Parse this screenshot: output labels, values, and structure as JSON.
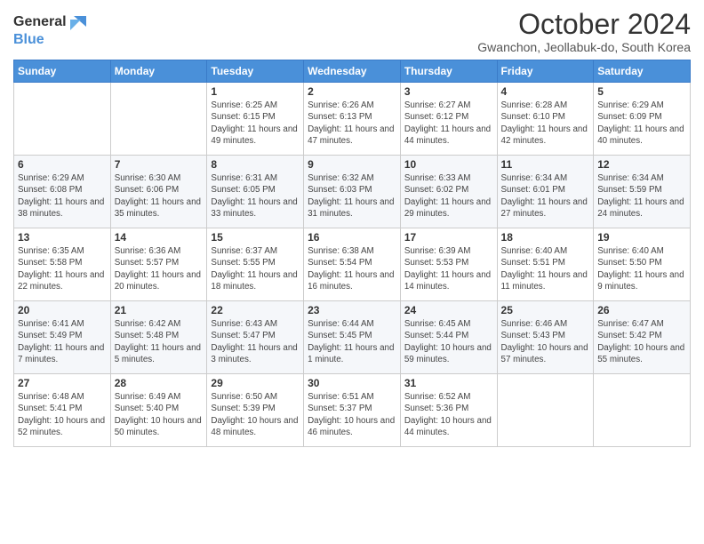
{
  "logo": {
    "general": "General",
    "blue": "Blue"
  },
  "title": "October 2024",
  "subtitle": "Gwanchon, Jeollabuk-do, South Korea",
  "weekdays": [
    "Sunday",
    "Monday",
    "Tuesday",
    "Wednesday",
    "Thursday",
    "Friday",
    "Saturday"
  ],
  "weeks": [
    [
      {
        "day": "",
        "info": ""
      },
      {
        "day": "",
        "info": ""
      },
      {
        "day": "1",
        "info": "Sunrise: 6:25 AM\nSunset: 6:15 PM\nDaylight: 11 hours and 49 minutes."
      },
      {
        "day": "2",
        "info": "Sunrise: 6:26 AM\nSunset: 6:13 PM\nDaylight: 11 hours and 47 minutes."
      },
      {
        "day": "3",
        "info": "Sunrise: 6:27 AM\nSunset: 6:12 PM\nDaylight: 11 hours and 44 minutes."
      },
      {
        "day": "4",
        "info": "Sunrise: 6:28 AM\nSunset: 6:10 PM\nDaylight: 11 hours and 42 minutes."
      },
      {
        "day": "5",
        "info": "Sunrise: 6:29 AM\nSunset: 6:09 PM\nDaylight: 11 hours and 40 minutes."
      }
    ],
    [
      {
        "day": "6",
        "info": "Sunrise: 6:29 AM\nSunset: 6:08 PM\nDaylight: 11 hours and 38 minutes."
      },
      {
        "day": "7",
        "info": "Sunrise: 6:30 AM\nSunset: 6:06 PM\nDaylight: 11 hours and 35 minutes."
      },
      {
        "day": "8",
        "info": "Sunrise: 6:31 AM\nSunset: 6:05 PM\nDaylight: 11 hours and 33 minutes."
      },
      {
        "day": "9",
        "info": "Sunrise: 6:32 AM\nSunset: 6:03 PM\nDaylight: 11 hours and 31 minutes."
      },
      {
        "day": "10",
        "info": "Sunrise: 6:33 AM\nSunset: 6:02 PM\nDaylight: 11 hours and 29 minutes."
      },
      {
        "day": "11",
        "info": "Sunrise: 6:34 AM\nSunset: 6:01 PM\nDaylight: 11 hours and 27 minutes."
      },
      {
        "day": "12",
        "info": "Sunrise: 6:34 AM\nSunset: 5:59 PM\nDaylight: 11 hours and 24 minutes."
      }
    ],
    [
      {
        "day": "13",
        "info": "Sunrise: 6:35 AM\nSunset: 5:58 PM\nDaylight: 11 hours and 22 minutes."
      },
      {
        "day": "14",
        "info": "Sunrise: 6:36 AM\nSunset: 5:57 PM\nDaylight: 11 hours and 20 minutes."
      },
      {
        "day": "15",
        "info": "Sunrise: 6:37 AM\nSunset: 5:55 PM\nDaylight: 11 hours and 18 minutes."
      },
      {
        "day": "16",
        "info": "Sunrise: 6:38 AM\nSunset: 5:54 PM\nDaylight: 11 hours and 16 minutes."
      },
      {
        "day": "17",
        "info": "Sunrise: 6:39 AM\nSunset: 5:53 PM\nDaylight: 11 hours and 14 minutes."
      },
      {
        "day": "18",
        "info": "Sunrise: 6:40 AM\nSunset: 5:51 PM\nDaylight: 11 hours and 11 minutes."
      },
      {
        "day": "19",
        "info": "Sunrise: 6:40 AM\nSunset: 5:50 PM\nDaylight: 11 hours and 9 minutes."
      }
    ],
    [
      {
        "day": "20",
        "info": "Sunrise: 6:41 AM\nSunset: 5:49 PM\nDaylight: 11 hours and 7 minutes."
      },
      {
        "day": "21",
        "info": "Sunrise: 6:42 AM\nSunset: 5:48 PM\nDaylight: 11 hours and 5 minutes."
      },
      {
        "day": "22",
        "info": "Sunrise: 6:43 AM\nSunset: 5:47 PM\nDaylight: 11 hours and 3 minutes."
      },
      {
        "day": "23",
        "info": "Sunrise: 6:44 AM\nSunset: 5:45 PM\nDaylight: 11 hours and 1 minute."
      },
      {
        "day": "24",
        "info": "Sunrise: 6:45 AM\nSunset: 5:44 PM\nDaylight: 10 hours and 59 minutes."
      },
      {
        "day": "25",
        "info": "Sunrise: 6:46 AM\nSunset: 5:43 PM\nDaylight: 10 hours and 57 minutes."
      },
      {
        "day": "26",
        "info": "Sunrise: 6:47 AM\nSunset: 5:42 PM\nDaylight: 10 hours and 55 minutes."
      }
    ],
    [
      {
        "day": "27",
        "info": "Sunrise: 6:48 AM\nSunset: 5:41 PM\nDaylight: 10 hours and 52 minutes."
      },
      {
        "day": "28",
        "info": "Sunrise: 6:49 AM\nSunset: 5:40 PM\nDaylight: 10 hours and 50 minutes."
      },
      {
        "day": "29",
        "info": "Sunrise: 6:50 AM\nSunset: 5:39 PM\nDaylight: 10 hours and 48 minutes."
      },
      {
        "day": "30",
        "info": "Sunrise: 6:51 AM\nSunset: 5:37 PM\nDaylight: 10 hours and 46 minutes."
      },
      {
        "day": "31",
        "info": "Sunrise: 6:52 AM\nSunset: 5:36 PM\nDaylight: 10 hours and 44 minutes."
      },
      {
        "day": "",
        "info": ""
      },
      {
        "day": "",
        "info": ""
      }
    ]
  ]
}
